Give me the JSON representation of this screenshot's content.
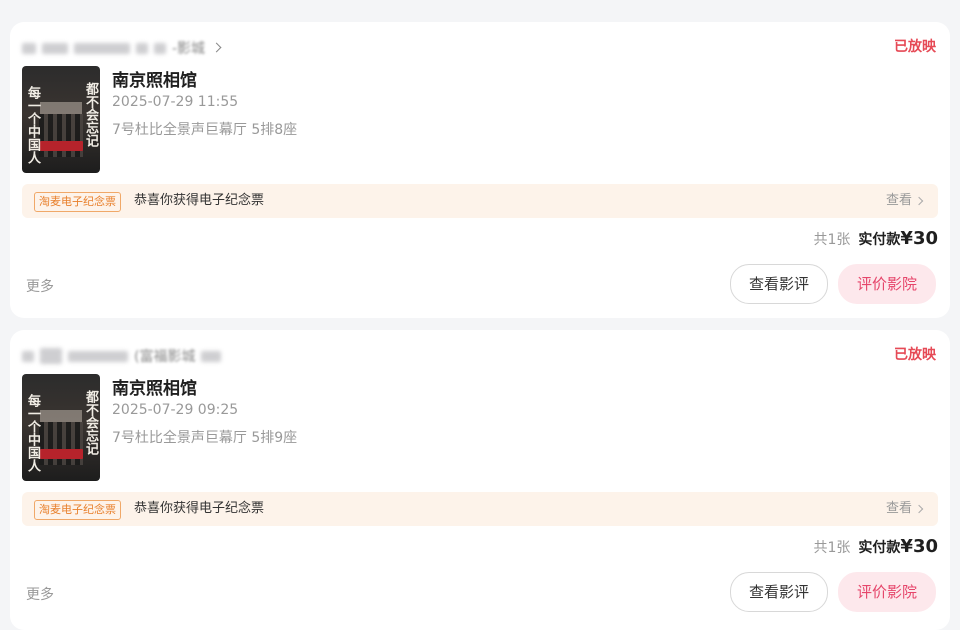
{
  "orders": [
    {
      "cinema_suffix": "-影城",
      "status": "已放映",
      "poster": {
        "left_text": "每一个中国人",
        "right_text": "都不会忘记"
      },
      "movie_title": "南京照相馆",
      "showtime": "2025-07-29 11:55",
      "seat": "7号杜比全景声巨幕厅 5排8座",
      "souvenir_tag": "淘麦电子纪念票",
      "souvenir_text": "恭喜你获得电子纪念票",
      "view_label": "查看",
      "total_count": "共1张",
      "paid_label": "实付款",
      "paid_amount": "¥30",
      "more_label": "更多",
      "review_button": "查看影评",
      "rate_button": "评价影院"
    },
    {
      "cinema_suffix": "(富福影城",
      "status": "已放映",
      "poster": {
        "left_text": "每一个中国人",
        "right_text": "都不会忘记"
      },
      "movie_title": "南京照相馆",
      "showtime": "2025-07-29 09:25",
      "seat": "7号杜比全景声巨幕厅 5排9座",
      "souvenir_tag": "淘麦电子纪念票",
      "souvenir_text": "恭喜你获得电子纪念票",
      "view_label": "查看",
      "total_count": "共1张",
      "paid_label": "实付款",
      "paid_amount": "¥30",
      "more_label": "更多",
      "review_button": "查看影评",
      "rate_button": "评价影院"
    }
  ],
  "colors": {
    "status": "#e64a56",
    "souvenir_bg": "#fdf3ea",
    "souvenir_tag": "#e87f2a",
    "rate_button_text": "#e6466b",
    "rate_button_bg": "#fde8ec"
  }
}
